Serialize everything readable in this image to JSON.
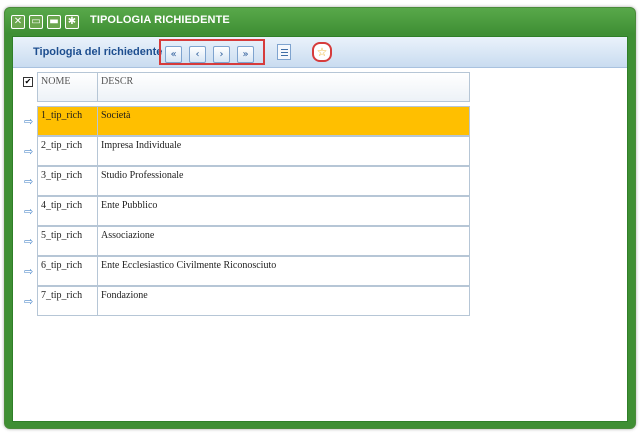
{
  "window": {
    "title": "TIPOLOGIA RICHIEDENTE",
    "icons": [
      "close-icon",
      "minimize-icon",
      "restore-icon",
      "settings-icon"
    ]
  },
  "toolbar": {
    "label": "Tipologia del richiedente",
    "nav": {
      "first": "«",
      "prev": "‹",
      "next": "›",
      "last": "»"
    },
    "favorite": "☆"
  },
  "table": {
    "columns": [
      "NOME",
      "DESCR"
    ],
    "selected_index": 0,
    "rows": [
      {
        "nome": "1_tip_rich",
        "descr": "Società"
      },
      {
        "nome": "2_tip_rich",
        "descr": "Impresa Individuale"
      },
      {
        "nome": "3_tip_rich",
        "descr": "Studio Professionale"
      },
      {
        "nome": "4_tip_rich",
        "descr": "Ente Pubblico"
      },
      {
        "nome": "5_tip_rich",
        "descr": "Associazione"
      },
      {
        "nome": "6_tip_rich",
        "descr": "Ente Ecclesiastico Civilmente Riconosciuto"
      },
      {
        "nome": "7_tip_rich",
        "descr": "Fondazione"
      }
    ]
  },
  "colors": {
    "window_green": "#3f8f34",
    "selection": "#ffbf00",
    "toolbar_text": "#1d4e8f"
  }
}
